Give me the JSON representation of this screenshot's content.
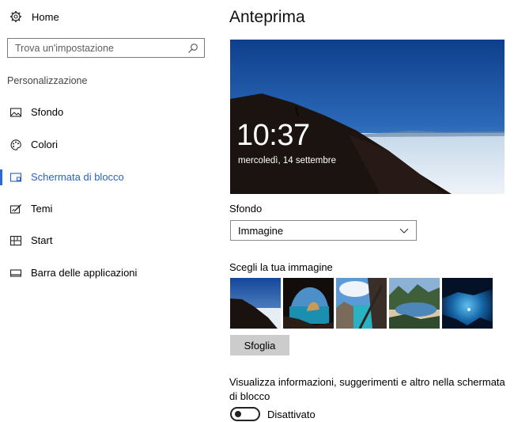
{
  "nav": {
    "home_label": "Home",
    "search_placeholder": "Trova un'impostazione",
    "section_title": "Personalizzazione",
    "items": [
      {
        "label": "Sfondo",
        "icon": "picture-icon",
        "active": false
      },
      {
        "label": "Colori",
        "icon": "palette-icon",
        "active": false
      },
      {
        "label": "Schermata di blocco",
        "icon": "lock-screen-icon",
        "active": true
      },
      {
        "label": "Temi",
        "icon": "themes-icon",
        "active": false
      },
      {
        "label": "Start",
        "icon": "start-icon",
        "active": false
      },
      {
        "label": "Barra delle applicazioni",
        "icon": "taskbar-icon",
        "active": false
      }
    ]
  },
  "main": {
    "title": "Anteprima",
    "preview": {
      "time": "10:37",
      "date": "mercoledì, 14 settembre"
    },
    "background_label": "Sfondo",
    "background_value": "Immagine",
    "choose_label": "Scegli la tua immagine",
    "browse_label": "Sfoglia",
    "info_text": "Visualizza informazioni, suggerimenti e altro nella schermata di blocco",
    "toggle_label": "Disattivato",
    "toggle_on": false
  },
  "colors": {
    "accent": "#2a6ad8"
  }
}
